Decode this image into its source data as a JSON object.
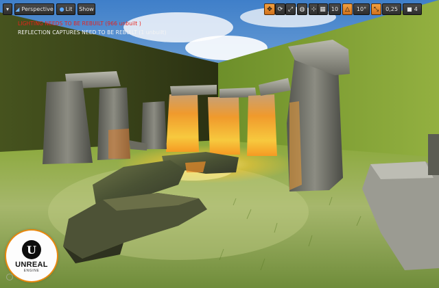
{
  "toolbar": {
    "menu_icon": "chevron-down-icon",
    "perspective_label": "Perspective",
    "lit_label": "Lit",
    "show_label": "Show",
    "grid_snap_value": "10",
    "rotation_snap_value": "10°",
    "scale_snap_value": "0,25",
    "camera_speed_value": "4",
    "accent_color": "#e38a2a"
  },
  "messages": {
    "lighting_warning": "LIGHTING NEEDS TO BE REBUILT (966 unbuilt )",
    "reflection_warning": "REFLECTION CAPTURES NEED TO BE REBUILT (1 unbuilt)"
  },
  "logo": {
    "mark": "U",
    "line1": "UNREAL",
    "line2": "ENGINE"
  }
}
